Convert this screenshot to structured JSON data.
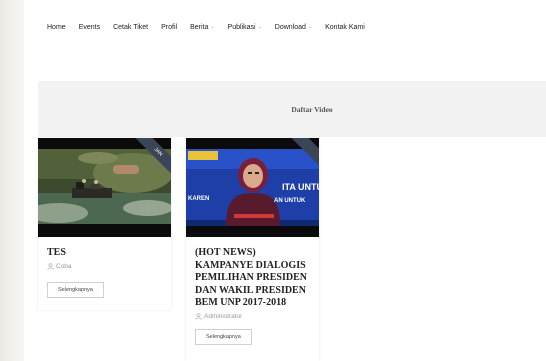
{
  "nav": {
    "items": [
      {
        "label": "Home",
        "dropdown": false
      },
      {
        "label": "Events",
        "dropdown": false
      },
      {
        "label": "Cetak Tiket",
        "dropdown": false
      },
      {
        "label": "Profil",
        "dropdown": false
      },
      {
        "label": "Berita",
        "dropdown": true
      },
      {
        "label": "Publikasi",
        "dropdown": true
      },
      {
        "label": "Download",
        "dropdown": true
      },
      {
        "label": "Kontak Kami",
        "dropdown": false
      }
    ]
  },
  "banner": {
    "title": "Daftar Video"
  },
  "videos": [
    {
      "title": "TES",
      "author": "Coba",
      "ribbon": "JAN",
      "button": "Selengkapnya"
    },
    {
      "title": "(HOT NEWS) KAMPANYE DIALOGIS PEMILIHAN PRESIDEN DAN WAKIL PRESIDEN BEM UNP 2017-2018",
      "author": "Administrator",
      "ribbon": "",
      "button": "Selengkapnya",
      "thumb_caption": "ITA UNTU UN KAREN AN UNTUK"
    }
  ],
  "colors": {
    "ribbon": "#3a4657",
    "thumb2_bg": "#1e3ea8"
  }
}
